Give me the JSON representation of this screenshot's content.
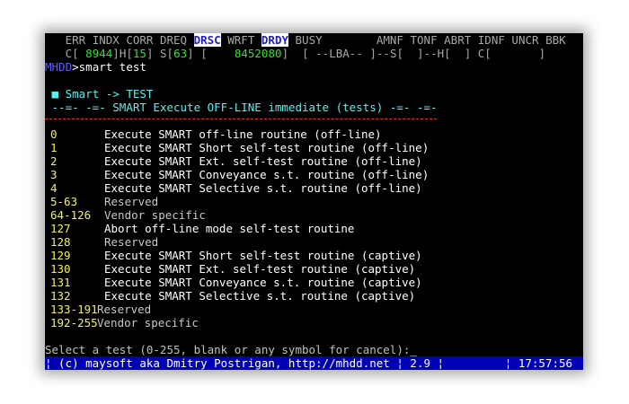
{
  "status_flags": {
    "err": "ERR",
    "indx": "INDX",
    "corr": "CORR",
    "dreq": "DREQ",
    "drsc": "DRSC",
    "wrft": "WRFT",
    "drdy": "DRDY",
    "busy": "BUSY",
    "amnf": "AMNF",
    "tonf": "TONF",
    "abrt": "ABRT",
    "idnf": "IDNF",
    "uncr": "UNCR",
    "bbk": "BBK"
  },
  "counters": {
    "c_label": "C[",
    "c_value": "8944",
    "h_label": "H[",
    "h_value": "15",
    "s_label": "S[",
    "s_value": "63",
    "lba_open": "[",
    "lba_value": "8452080",
    "tail": "[ --LBA-- ]--S[  ]--H[  ] C[       ]"
  },
  "prompt": {
    "program": "MHDD",
    "arrow": ">",
    "command": "smart test"
  },
  "menu": {
    "bullet": "■",
    "title": "Smart -> TEST",
    "subtitle": "--=- -=- SMART Execute OFF-LINE immediate (tests) -=- -=-"
  },
  "tests": [
    {
      "code": "0",
      "desc": "Execute SMART off-line routine (off-line)"
    },
    {
      "code": "1",
      "desc": "Execute SMART Short self-test routine (off-line)"
    },
    {
      "code": "2",
      "desc": "Execute SMART Ext. self-test routine (off-line)"
    },
    {
      "code": "3",
      "desc": "Execute SMART Conveyance s.t. routine (off-line)"
    },
    {
      "code": "4",
      "desc": "Execute SMART Selective s.t. routine (off-line)"
    },
    {
      "code": "5-63",
      "desc": "Reserved"
    },
    {
      "code": "64-126",
      "desc": "Vendor specific"
    },
    {
      "code": "127",
      "desc": "Abort off-line mode self-test routine"
    },
    {
      "code": "128",
      "desc": "Reserved"
    },
    {
      "code": "129",
      "desc": "Execute SMART Short self-test routine (captive)"
    },
    {
      "code": "130",
      "desc": "Execute SMART Ext. self-test routine (captive)"
    },
    {
      "code": "131",
      "desc": "Execute SMART Conveyance s.t. routine (captive)"
    },
    {
      "code": "132",
      "desc": "Execute SMART Selective s.t. routine (captive)"
    },
    {
      "code": "133-191",
      "desc": "Reserved"
    },
    {
      "code": "192-255",
      "desc": "Vendor specific"
    }
  ],
  "input_prompt": "Select a test (0-255, blank or any symbol for cancel):",
  "footer": {
    "copyright": "¦ (c) maysoft aka Dmitry Postrigan, http://mhdd.net ¦",
    "version": "2.9",
    "sep": "¦",
    "time": "¦ 17:57:56"
  },
  "colors": {
    "background": "#000000",
    "code": "#f1f15a",
    "highlight_bg": "#ffffff",
    "highlight_fg": "#1f1fc8",
    "counter": "#33e033",
    "menu": "#58f0f0",
    "separator": "#e23030",
    "footer_bg": "#0000b4"
  }
}
